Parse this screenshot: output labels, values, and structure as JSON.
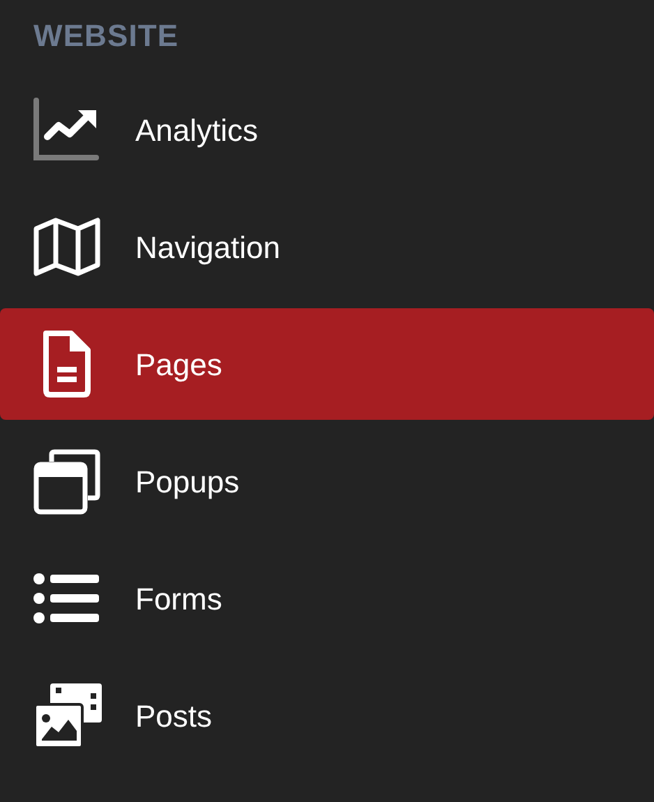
{
  "section": {
    "title": "WEBSITE"
  },
  "items": [
    {
      "label": "Analytics",
      "kind": "chart",
      "selected": false
    },
    {
      "label": "Navigation",
      "kind": "map",
      "selected": false
    },
    {
      "label": "Pages",
      "kind": "page",
      "selected": true
    },
    {
      "label": "Popups",
      "kind": "windows",
      "selected": false
    },
    {
      "label": "Forms",
      "kind": "list",
      "selected": false
    },
    {
      "label": "Posts",
      "kind": "media",
      "selected": false
    }
  ]
}
